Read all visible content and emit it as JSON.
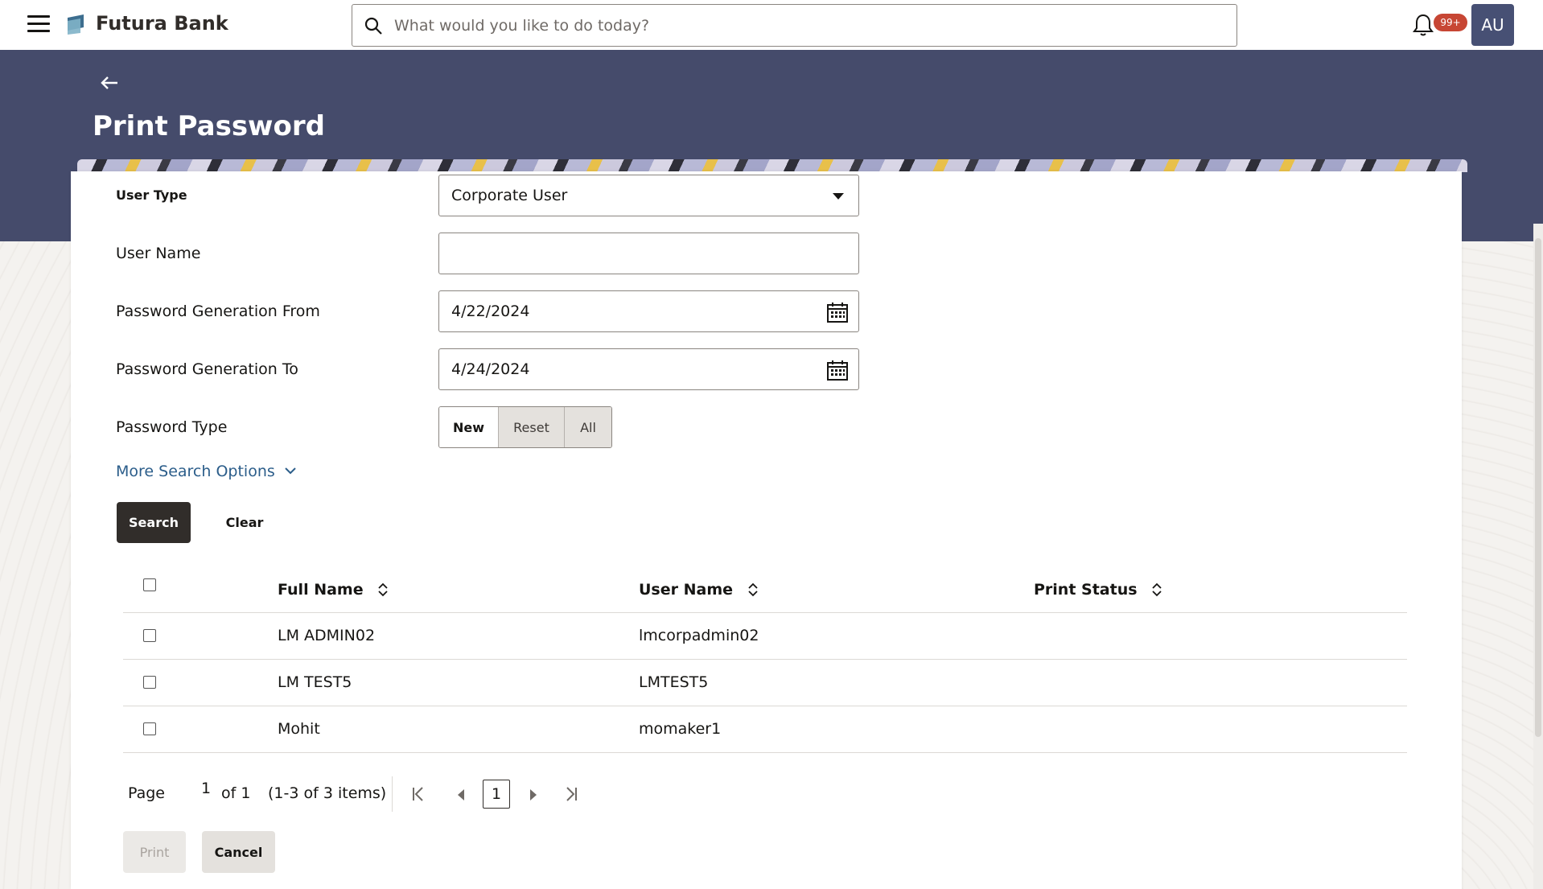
{
  "app": {
    "brand": "Futura Bank",
    "search_placeholder": "What would you like to do today?",
    "notification_count": "99+",
    "avatar_initials": "AU"
  },
  "page": {
    "title": "Print Password"
  },
  "form": {
    "user_type_label": "User Type",
    "user_type_value": "Corporate User",
    "user_name_label": "User Name",
    "user_name_value": "",
    "gen_from_label": "Password Generation From",
    "gen_from_value": "4/22/2024",
    "gen_to_label": "Password Generation To",
    "gen_to_value": "4/24/2024",
    "password_type_label": "Password Type",
    "password_type_options": [
      "New",
      "Reset",
      "All"
    ],
    "password_type_selected": "New",
    "more_options_label": "More Search Options",
    "search_label": "Search",
    "clear_label": "Clear"
  },
  "table": {
    "columns": [
      "Full Name",
      "User Name",
      "Print Status"
    ],
    "rows": [
      {
        "full_name": "LM ADMIN02",
        "user_name": "lmcorpadmin02",
        "print_status": ""
      },
      {
        "full_name": "LM TEST5",
        "user_name": "LMTEST5",
        "print_status": ""
      },
      {
        "full_name": "Mohit",
        "user_name": "momaker1",
        "print_status": ""
      }
    ]
  },
  "pagination": {
    "page_label": "Page",
    "current_page": "1",
    "of_label": "of 1",
    "items_label": "(1-3 of 3 items)",
    "page_button": "1"
  },
  "actions": {
    "print_label": "Print",
    "cancel_label": "Cancel"
  },
  "colors": {
    "header_band": "#454b6b",
    "primary_button": "#312d2a",
    "link": "#2b5d8a",
    "badge": "#c74634",
    "avatar": "#475074"
  }
}
